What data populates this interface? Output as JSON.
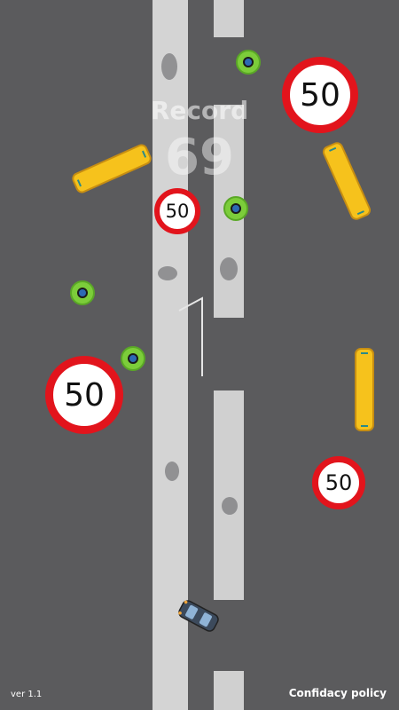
{
  "record": {
    "label": "Record",
    "value": "69"
  },
  "signs": [
    {
      "id": "sign-top-right",
      "text": "50"
    },
    {
      "id": "sign-center",
      "text": "50"
    },
    {
      "id": "sign-left",
      "text": "50"
    },
    {
      "id": "sign-right-low",
      "text": "50"
    }
  ],
  "footer": {
    "version": "ver 1.1",
    "policy_link": "Confidacy policy"
  },
  "colors": {
    "road": "#5b5b5d",
    "lane_marking": "#d4d4d4",
    "sign_border": "#e2141c",
    "bus": "#f6c21c",
    "coin": "#7ccd3a",
    "player_car": "#3c4a5c"
  }
}
